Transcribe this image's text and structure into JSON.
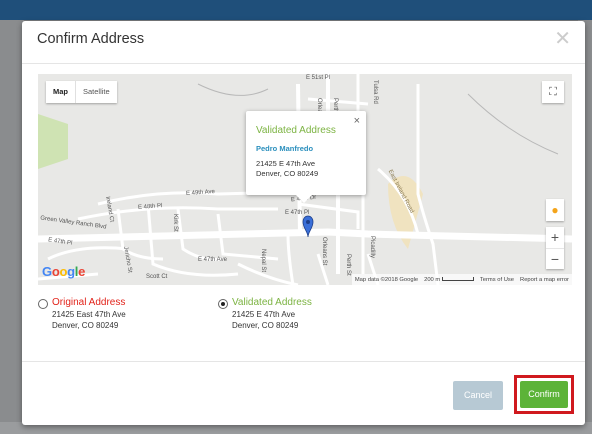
{
  "modal": {
    "title": "Confirm Address",
    "close_icon": "close-icon"
  },
  "map": {
    "type_controls": {
      "map_label": "Map",
      "satellite_label": "Satellite"
    },
    "fullscreen_icon": "fullscreen-icon",
    "pegman_icon": "pegman-icon",
    "zoom_in_label": "+",
    "zoom_out_label": "−",
    "logo": "Google",
    "attribution": {
      "map_data": "Map data ©2018 Google",
      "scale": "200 m",
      "terms": "Terms of Use",
      "report": "Report a map error"
    },
    "roads": [
      "E 51st Pl",
      "Orleans St",
      "Perth St",
      "Tulsa Rd",
      "E 49th Ave",
      "E 48th Pl",
      "Kirk St",
      "Ireland Ct",
      "Green Valley Ranch Blvd",
      "E 47th Pl",
      "E 47th Ave",
      "Scott Ct",
      "E 48th Dr",
      "E 47th Pl",
      "Orleans St",
      "Perth St",
      "Picadilly",
      "East Ireland Road",
      "Nepal St",
      "Jericho St"
    ],
    "info_window": {
      "title": "Validated Address",
      "name": "Pedro Manfredo",
      "line1": "21425 E 47th Ave",
      "line2": "Denver, CO 80249",
      "close": "×"
    }
  },
  "addresses": {
    "original": {
      "label": "Original Address",
      "line1": "21425 East 47th Ave",
      "line2": "Denver, CO 80249",
      "selected": false
    },
    "validated": {
      "label": "Validated Address",
      "line1": "21425 E 47th Ave",
      "line2": "Denver, CO 80249",
      "selected": true
    }
  },
  "footer": {
    "cancel_label": "Cancel",
    "confirm_label": "Confirm"
  },
  "colors": {
    "topbar": "#1f4f7a",
    "validated_green": "#7cb342",
    "original_red": "#e2231a",
    "confirm_green": "#5cb338",
    "cancel_blue": "#b7c9d4",
    "highlight_red": "#d0191e"
  }
}
